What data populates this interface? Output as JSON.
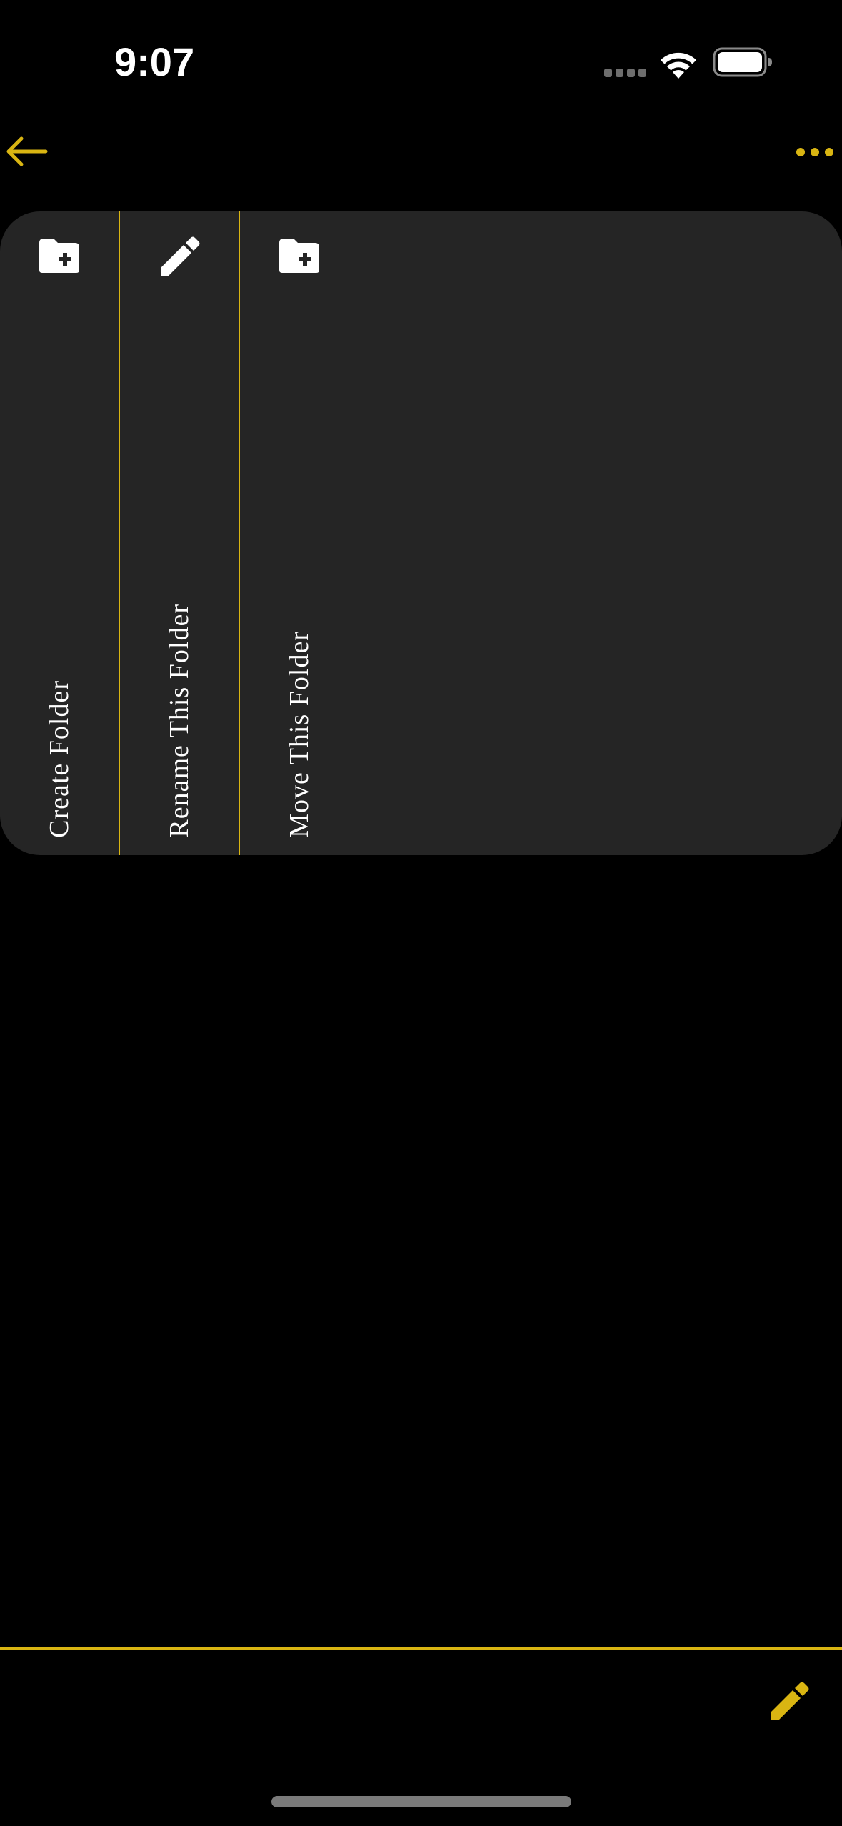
{
  "status_bar": {
    "time": "9:07"
  },
  "nav": {
    "back_icon": "arrow-left-icon",
    "more_icon": "ellipsis-icon"
  },
  "menu": {
    "items": [
      {
        "label": "Create Folder",
        "icon": "folder-plus-icon"
      },
      {
        "label": "Rename This Folder",
        "icon": "pencil-icon"
      },
      {
        "label": "Move This Folder",
        "icon": "folder-plus-icon"
      }
    ]
  },
  "toolbar": {
    "compose_icon": "pencil-icon"
  },
  "colors": {
    "accent": "#d9b512",
    "panel_background": "#252525",
    "background": "#000000",
    "text": "#ffffff"
  }
}
